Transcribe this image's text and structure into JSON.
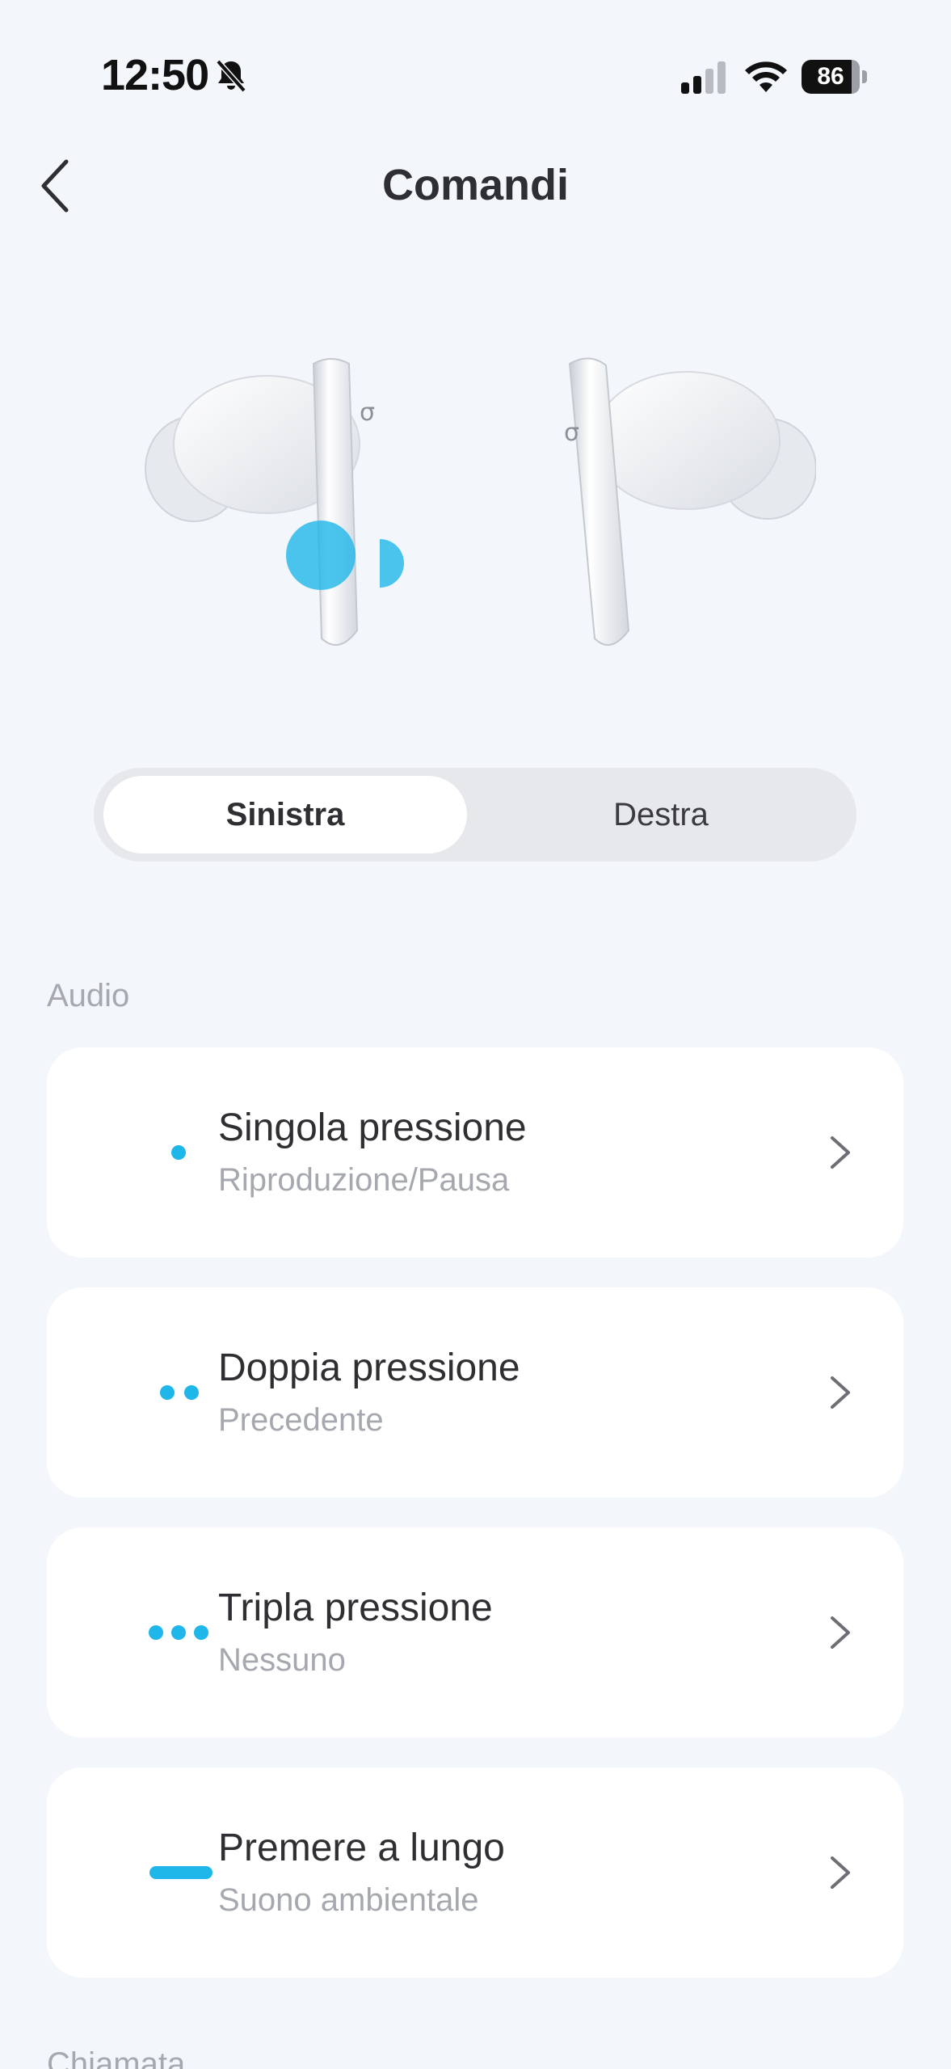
{
  "status_bar": {
    "time": "12:50",
    "battery": "86",
    "icons": [
      "bell-slash-icon",
      "signal-icon",
      "wifi-icon",
      "battery-icon"
    ]
  },
  "nav": {
    "title": "Comandi",
    "back_icon": "chevron-left-icon"
  },
  "tabs": {
    "left": "Sinistra",
    "right": "Destra",
    "selected": "Sinistra"
  },
  "sections": {
    "audio": "Audio",
    "call": "Chiamata"
  },
  "controls": [
    {
      "title": "Singola pressione",
      "action": "Riproduzione/Pausa",
      "indicator": "single-dot"
    },
    {
      "title": "Doppia pressione",
      "action": "Precedente",
      "indicator": "double-dot"
    },
    {
      "title": "Tripla pressione",
      "action": "Nessuno",
      "indicator": "triple-dot"
    },
    {
      "title": "Premere a lungo",
      "action": "Suono ambientale",
      "indicator": "long-dash"
    }
  ],
  "colors": {
    "accent": "#1fb6ea",
    "background": "#f3f6fa",
    "card": "#ffffff"
  }
}
